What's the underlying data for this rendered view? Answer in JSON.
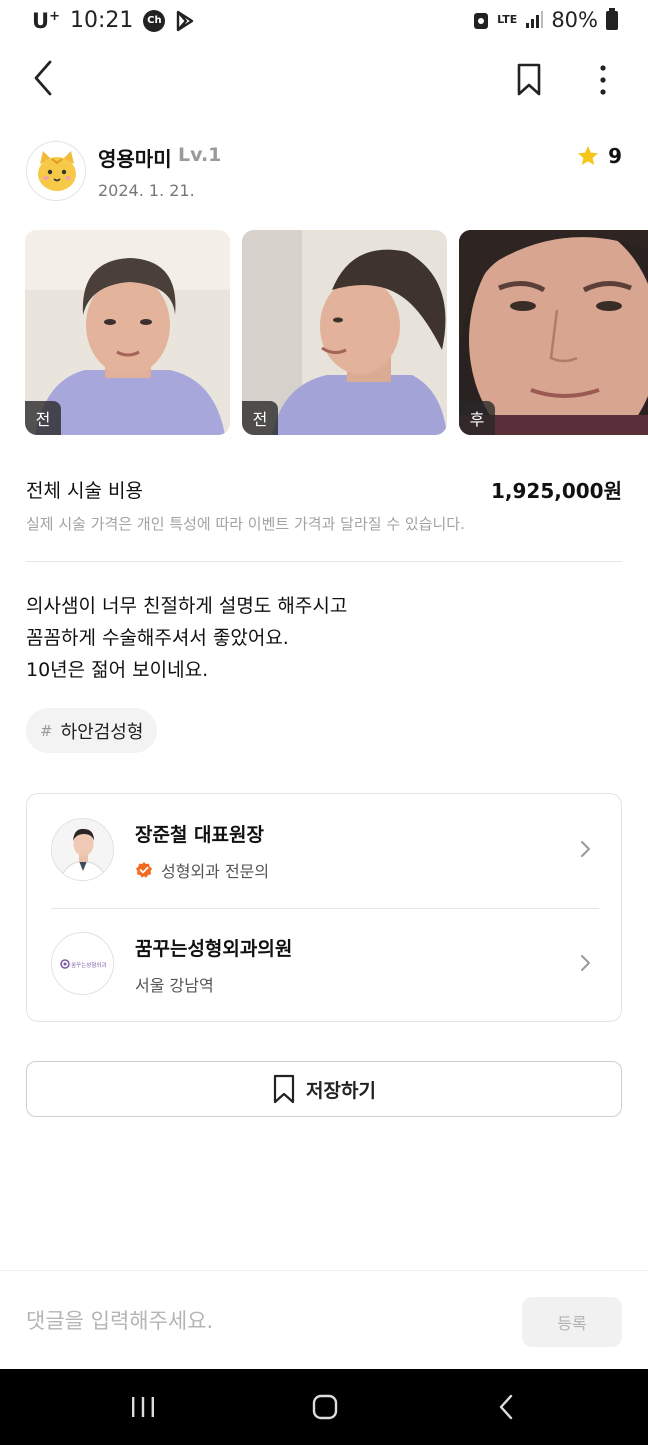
{
  "status_bar": {
    "carrier": "U",
    "carrier_sup": "+",
    "time": "10:21",
    "chat_icon_text": "Ch",
    "network": "LTE",
    "battery": "80%"
  },
  "nav": {
    "back_icon": "chevron-left-icon",
    "bookmark_icon": "bookmark-icon",
    "more_icon": "more-vertical-icon"
  },
  "profile": {
    "username": "영용마미",
    "level": "Lv.1",
    "date": "2024. 1. 21.",
    "rating": "9",
    "rating_color": "#f5c518"
  },
  "photos": [
    {
      "tag": "전"
    },
    {
      "tag": "전"
    },
    {
      "tag": "후"
    }
  ],
  "cost": {
    "label": "전체 시술 비용",
    "value": "1,925,000원",
    "note": "실제 시술 가격은 개인 특성에 따라 이벤트 가격과 달라질 수 있습니다."
  },
  "review": {
    "lines": [
      "의사샘이 너무 친절하게 설명도 해주시고",
      "꼼꼼하게 수술해주셔서 좋았어요.",
      "10년은 젊어 보이네요."
    ]
  },
  "tag": {
    "hash": "#",
    "text": "하안검성형"
  },
  "doctor": {
    "name": "장준철 대표원장",
    "specialty": "성형외과 전문의",
    "verified_color": "#f26b21"
  },
  "clinic": {
    "name": "꿈꾸는성형외과의원",
    "location": "서울 강남역",
    "logo_text": "꿈꾸는성형외과"
  },
  "save": {
    "label": "저장하기"
  },
  "comment": {
    "placeholder": "댓글을 입력해주세요.",
    "submit_label": "등록"
  }
}
